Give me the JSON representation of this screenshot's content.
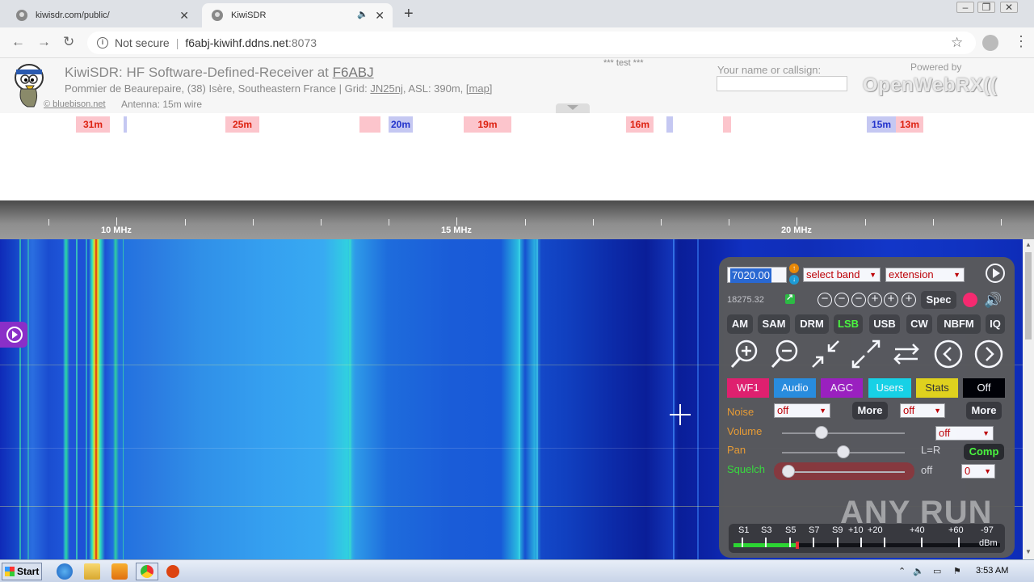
{
  "browser": {
    "tabs": [
      {
        "title": "kiwisdr.com/public/",
        "active": false
      },
      {
        "title": "KiwiSDR",
        "active": true
      }
    ],
    "url": {
      "security_label": "Not secure",
      "host": "f6abj-kiwihf.ddns.net",
      "port": ":8073"
    }
  },
  "kiwi_header": {
    "title_prefix": "KiwiSDR: HF Software-Defined-Receiver at ",
    "callsign": "F6ABJ",
    "location": "Pommier de Beaurepaire, (38) Isère, Southeastern France | Grid: ",
    "grid": "JN25nj",
    "asl": ", ASL: 390m, ",
    "map_link": "[map]",
    "credit": "© bluebison.net",
    "antenna": "Antenna: 15m wire",
    "test_notice": "*** test ***",
    "name_label": "Your name or callsign:",
    "name_value": "",
    "powered_by": "Powered by",
    "powered_brand": "OpenWebRX(("
  },
  "band_bar": [
    {
      "label": "31m",
      "kind": "red"
    },
    {
      "label": "",
      "kind": "blue"
    },
    {
      "label": "25m",
      "kind": "red"
    },
    {
      "label": "",
      "kind": "red"
    },
    {
      "label": "20m",
      "kind": "blue"
    },
    {
      "label": "19m",
      "kind": "red"
    },
    {
      "label": "16m",
      "kind": "red"
    },
    {
      "label": "",
      "kind": "blue"
    },
    {
      "label": "",
      "kind": "red"
    },
    {
      "label": "15m",
      "kind": "blue"
    },
    {
      "label": "13m",
      "kind": "red"
    }
  ],
  "scale": {
    "labels": [
      "10 MHz",
      "15 MHz",
      "20 MHz"
    ]
  },
  "panel": {
    "frequency": "7020.00",
    "band_select": "select band",
    "extension_select": "extension",
    "display_freq": "18275.32",
    "spec_label": "Spec",
    "modes": [
      "AM",
      "SAM",
      "DRM",
      "LSB",
      "USB",
      "CW",
      "NBFM",
      "IQ"
    ],
    "active_mode": "LSB",
    "tabs": [
      {
        "label": "WF1",
        "bg": "#e8206c",
        "fg": "#ffffff"
      },
      {
        "label": "Audio",
        "bg": "#2a90e0",
        "fg": "#ffffff"
      },
      {
        "label": "AGC",
        "bg": "#a020c0",
        "fg": "#ffffff"
      },
      {
        "label": "Users",
        "bg": "#18d8e8",
        "fg": "#ffffff"
      },
      {
        "label": "Stats",
        "bg": "#e8d818",
        "fg": "#333333"
      },
      {
        "label": "Off",
        "bg": "#000000",
        "fg": "#ffffff"
      }
    ],
    "noise_label": "Noise",
    "noise_select": "off",
    "noise_more": "More",
    "noise_select2": "off",
    "noise_more2": "More",
    "volume_label": "Volume",
    "volume_select": "off",
    "pan_label": "Pan",
    "pan_value": "L=R",
    "comp_label": "Comp",
    "squelch_label": "Squelch",
    "squelch_value": "off",
    "squelch_select": "0",
    "volume_level": 0.3,
    "pan_level": 0.5,
    "squelch_level": 0.0,
    "smeter": {
      "labels": [
        "S1",
        "S3",
        "S5",
        "S7",
        "S9",
        "+10",
        "+20",
        "+40",
        "+60"
      ],
      "value": "-97",
      "unit": "dBm",
      "level": 0.24
    }
  },
  "watermark": "ANY RUN",
  "taskbar": {
    "start": "Start",
    "clock": "3:53 AM"
  }
}
